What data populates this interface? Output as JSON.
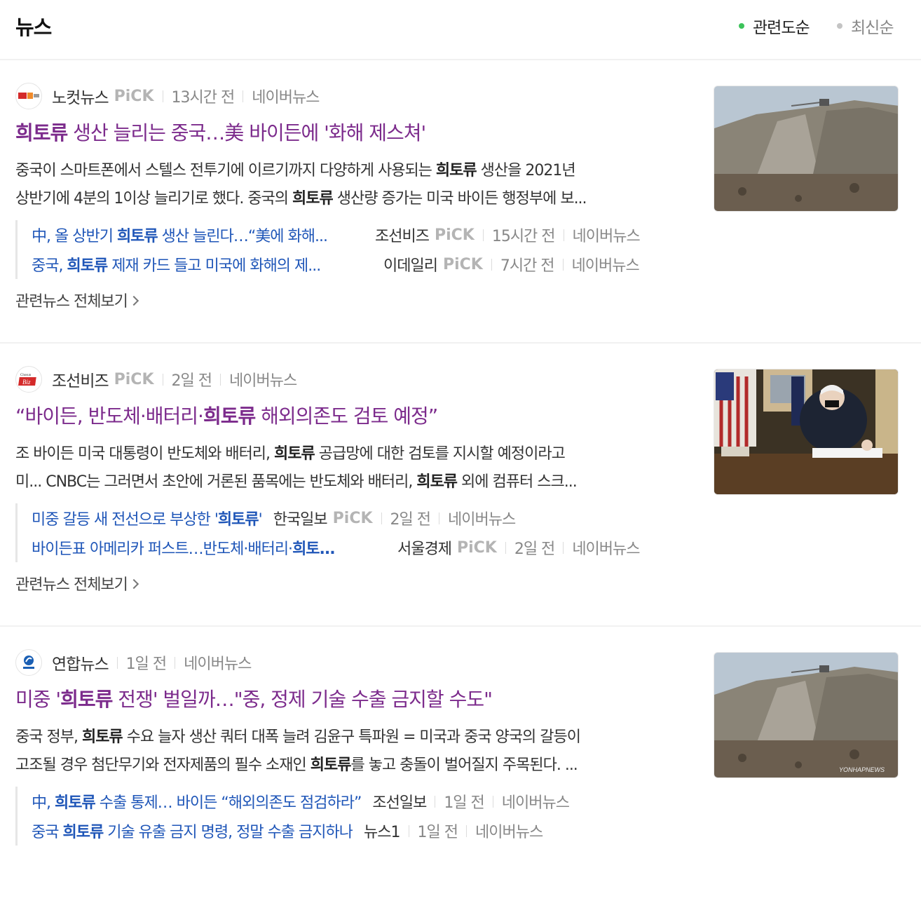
{
  "header": {
    "title": "뉴스",
    "sort_relevance": "관련도순",
    "sort_latest": "최신순"
  },
  "articles": [
    {
      "press": "노컷뉴스",
      "pick": "PiCK",
      "time": "13시간 전",
      "platform": "네이버뉴스",
      "title_keyword": "희토류",
      "title_rest": " 생산 늘리는 중국…美 바이든에 '화해 제스쳐'",
      "desc1_a": "중국이 스마트폰에서 스텔스 전투기에 이르기까지 다양하게 사용되는 ",
      "desc1_kw": "희토류",
      "desc1_b": " 생산을 2021년",
      "desc2_a": "상반기에 4분의 1이상 늘리기로 했다. 중국의 ",
      "desc2_kw": "희토류",
      "desc2_b": " 생산량 증가는 미국 바이든 행정부에 보...",
      "related": [
        {
          "pre": "中, 올 상반기 ",
          "kw": "희토류",
          "post": " 생산 늘린다…“美에 화해...",
          "press": "조선비즈",
          "pick": "PiCK",
          "time": "15시간 전",
          "platform": "네이버뉴스"
        },
        {
          "pre": "중국, ",
          "kw": "희토류",
          "post": " 제재 카드 들고 미국에 화해의 제...",
          "press": "이데일리",
          "pick": "PiCK",
          "time": "7시간 전",
          "platform": "네이버뉴스"
        }
      ],
      "view_all": "관련뉴스 전체보기"
    },
    {
      "press": "조선비즈",
      "pick": "PiCK",
      "time": "2일 전",
      "platform": "네이버뉴스",
      "title_pre": "“바이든, 반도체·배터리·",
      "title_keyword": "희토류",
      "title_rest": " 해외의존도 검토 예정”",
      "desc1_a": "조 바이든 미국 대통령이 반도체와 배터리, ",
      "desc1_kw": "희토류",
      "desc1_b": " 공급망에 대한 검토를 지시할 예정이라고",
      "desc2_a": "미... CNBC는 그러면서 초안에 거론된 품목에는 반도체와 배터리, ",
      "desc2_kw": "희토류",
      "desc2_b": " 외에 컴퓨터 스크...",
      "related": [
        {
          "pre": "미중 갈등 새 전선으로 부상한 '",
          "kw": "희토류",
          "post": "'",
          "press": "한국일보",
          "pick": "PiCK",
          "time": "2일 전",
          "platform": "네이버뉴스"
        },
        {
          "pre": "바이든표 아메리카 퍼스트…반도체·배터리·",
          "kw": "희토...",
          "post": "",
          "press": "서울경제",
          "pick": "PiCK",
          "time": "2일 전",
          "platform": "네이버뉴스"
        }
      ],
      "view_all": "관련뉴스 전체보기"
    },
    {
      "press": "연합뉴스",
      "time": "1일 전",
      "platform": "네이버뉴스",
      "title_pre": "미중 '",
      "title_keyword": "희토류",
      "title_rest": " 전쟁' 벌일까…\"중, 정제 기술 수출 금지할 수도\"",
      "desc1_a": "중국 정부, ",
      "desc1_kw": "희토류",
      "desc1_b": " 수요 늘자 생산 쿼터 대폭 늘려 김윤구 특파원 = 미국과 중국 양국의 갈등이",
      "desc2_a": "고조될 경우 첨단무기와 전자제품의 필수 소재인 ",
      "desc2_kw": "희토류",
      "desc2_b": "를 놓고 충돌이 벌어질지 주목된다. ...",
      "related": [
        {
          "pre": "中, ",
          "kw": "희토류",
          "post": " 수출 통제… 바이든 “해외의존도 점검하라”",
          "press": "조선일보",
          "time": "1일 전",
          "platform": "네이버뉴스"
        },
        {
          "pre": "중국 ",
          "kw": "희토류",
          "post": " 기술 유출 금지 명령, 정말 수출 금지하나",
          "press": "뉴스1",
          "time": "1일 전",
          "platform": "네이버뉴스"
        }
      ],
      "watermark": "YONHAPNEWS"
    }
  ],
  "icons": [
    "nocut-logo-icon",
    "chosunbiz-logo-icon",
    "yonhap-logo-icon",
    "chevron-right-icon"
  ],
  "colors": {
    "title": "#7c2b8c",
    "related_link": "#1f56b8",
    "active_dot": "#3cc35a",
    "inactive_dot": "#c4c4c4"
  }
}
